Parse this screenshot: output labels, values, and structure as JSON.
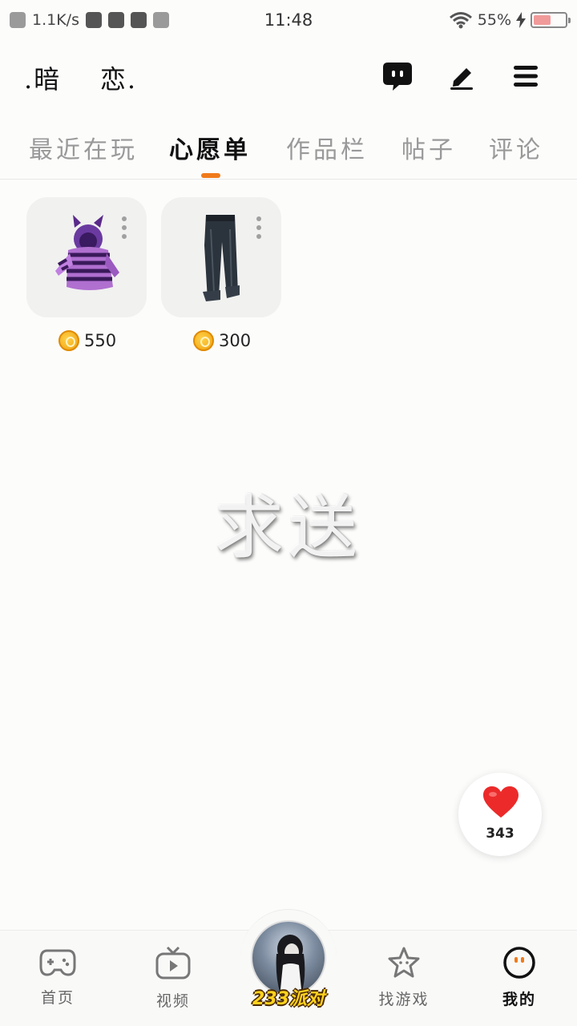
{
  "status_bar": {
    "net_speed": "1.1K/s",
    "time": "11:48",
    "battery": "55%",
    "battery_level": 0.55
  },
  "header": {
    "profile_name": ".暗    恋.",
    "icons": [
      "chat-bubble-icon",
      "pen-icon",
      "menu-icon"
    ]
  },
  "tabs": [
    {
      "label": "最近在玩",
      "active": false
    },
    {
      "label": "心愿单",
      "active": true
    },
    {
      "label": "作品栏",
      "active": false
    },
    {
      "label": "帖子",
      "active": false
    },
    {
      "label": "评论",
      "active": false
    }
  ],
  "wishlist": [
    {
      "item": "purple-striped-hoodie",
      "price": "550"
    },
    {
      "item": "dark-jeans",
      "price": "300"
    }
  ],
  "overlay_text": "求送",
  "likes": {
    "count": "343"
  },
  "bottom_nav": [
    {
      "label": "首页",
      "icon": "gamepad-icon",
      "active": false
    },
    {
      "label": "视频",
      "icon": "tv-play-icon",
      "active": false
    },
    {
      "label": "233派对",
      "icon": "party-avatar",
      "active": false
    },
    {
      "label": "找游戏",
      "icon": "star-icon",
      "active": false
    },
    {
      "label": "我的",
      "icon": "face-icon",
      "active": true
    }
  ],
  "colors": {
    "accent": "#f07a1a",
    "heart": "#ec2a2a",
    "coin": "#f5b21c"
  }
}
